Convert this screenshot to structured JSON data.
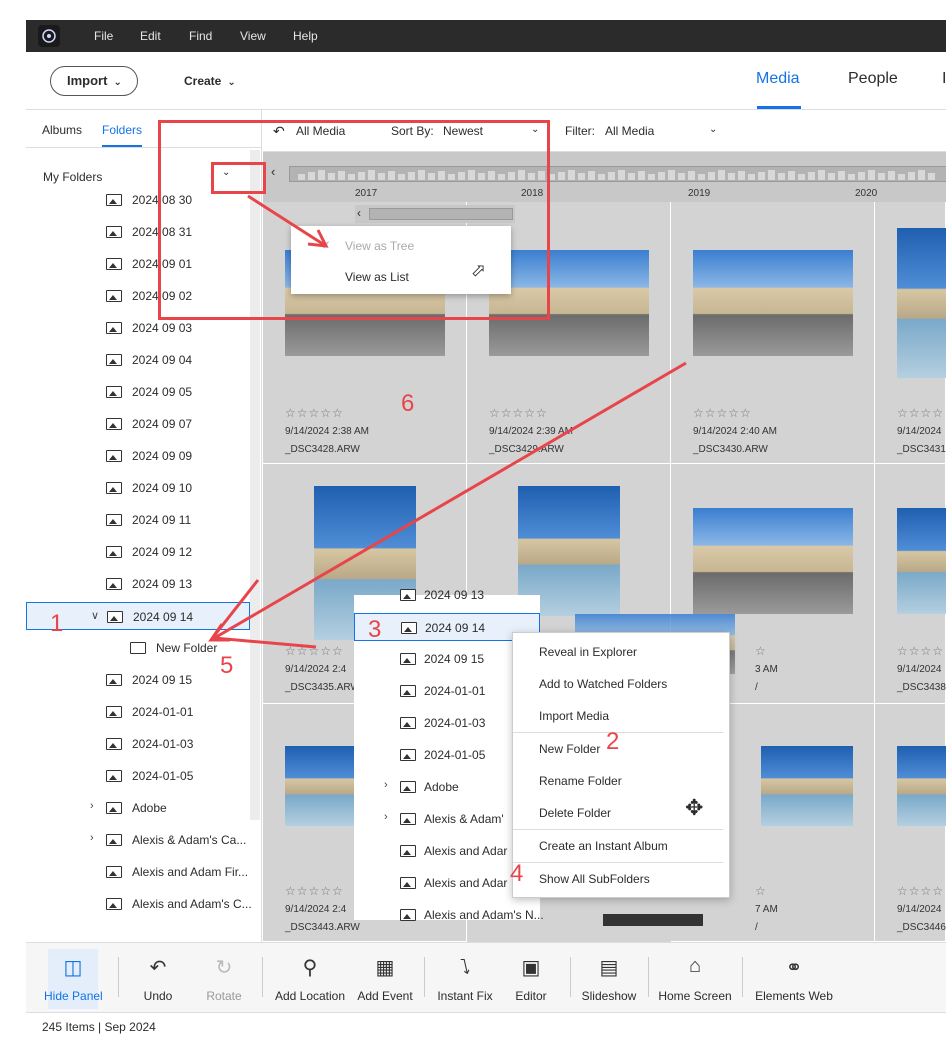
{
  "menu": {
    "items": [
      "File",
      "Edit",
      "Find",
      "View",
      "Help"
    ]
  },
  "header": {
    "import_label": "Import",
    "create_label": "Create",
    "tabs": {
      "media": "Media",
      "people": "People",
      "edge": "I"
    }
  },
  "left_panel": {
    "tabs": {
      "albums": "Albums",
      "folders": "Folders"
    },
    "my_folders": "My Folders",
    "folders": [
      "2024 08 30",
      "2024 08 31",
      "2024 09 01",
      "2024 09 02",
      "2024 09 03",
      "2024 09 04",
      "2024 09 05",
      "2024 09 07",
      "2024 09 09",
      "2024 09 10",
      "2024 09 11",
      "2024 09 12",
      "2024 09 13",
      "2024 09 14",
      "New Folder",
      "2024 09 15",
      "2024-01-01",
      "2024-01-03",
      "2024-01-05",
      "Adobe",
      "Alexis & Adam's Ca...",
      "Alexis and Adam Fir...",
      "Alexis and Adam's C..."
    ]
  },
  "toolbar": {
    "all_media": "All Media",
    "sort_by_label": "Sort By:",
    "sort_by_value": "Newest",
    "filter_label": "Filter:",
    "filter_value": "All Media"
  },
  "timeline": {
    "years": [
      "2017",
      "2018",
      "2019",
      "2020"
    ]
  },
  "view_as_popup": {
    "tree": "View as Tree",
    "list": "View as List"
  },
  "grid": {
    "row1": [
      {
        "stars": "☆☆☆☆☆",
        "date": "9/14/2024 2:38 AM",
        "file": "_DSC3428.ARW"
      },
      {
        "stars": "☆☆☆☆☆",
        "date": "9/14/2024 2:39 AM",
        "file": "_DSC3429.ARW"
      },
      {
        "stars": "☆☆☆☆☆",
        "date": "9/14/2024 2:40 AM",
        "file": "_DSC3430.ARW"
      },
      {
        "stars": "☆☆☆☆",
        "date": "9/14/2024",
        "file": "_DSC3431"
      }
    ],
    "row2": [
      {
        "stars": "☆☆☆☆☆",
        "date": "9/14/2024 2:4",
        "file": "_DSC3435.ARW"
      },
      {
        "stars": "☆",
        "date": "3 AM",
        "file": "/"
      },
      {
        "stars": "☆☆☆☆",
        "date": "9/14/2024",
        "file": "_DSC3438"
      }
    ],
    "row3": [
      {
        "stars": "☆☆☆☆☆",
        "date": "9/14/2024 2:4",
        "file": "_DSC3443.ARW"
      },
      {
        "stars": "☆",
        "date": "7 AM",
        "file": "/"
      },
      {
        "stars": "☆☆☆☆",
        "date": "9/14/2024",
        "file": "_DSC3446"
      }
    ]
  },
  "floating_list": [
    "2024 09 13",
    "2024 09 14",
    "2024 09 15",
    "2024-01-01",
    "2024-01-03",
    "2024-01-05",
    "Adobe",
    "Alexis & Adam'",
    "Alexis and Adar",
    "Alexis and Adar",
    "Alexis and Adam's N..."
  ],
  "context_menu": {
    "items": [
      "Reveal in Explorer",
      "Add to Watched Folders",
      "Import Media",
      "New Folder",
      "Rename Folder",
      "Delete Folder",
      "Create an Instant Album",
      "Show All SubFolders"
    ]
  },
  "bottom_bar": {
    "hide_panel": "Hide Panel",
    "undo": "Undo",
    "rotate": "Rotate",
    "add_location": "Add Location",
    "add_event": "Add Event",
    "instant_fix": "Instant Fix",
    "editor": "Editor",
    "slideshow": "Slideshow",
    "home_screen": "Home Screen",
    "elements_web": "Elements Web"
  },
  "status": {
    "text": "245 Items | Sep 2024"
  },
  "annotations": {
    "n1": "1",
    "n2": "2",
    "n3": "3",
    "n4": "4",
    "n5": "5",
    "n6": "6"
  },
  "colors": {
    "accent": "#1473e6",
    "annotation": "#e8454a",
    "titlebar": "#2b2b2b"
  }
}
